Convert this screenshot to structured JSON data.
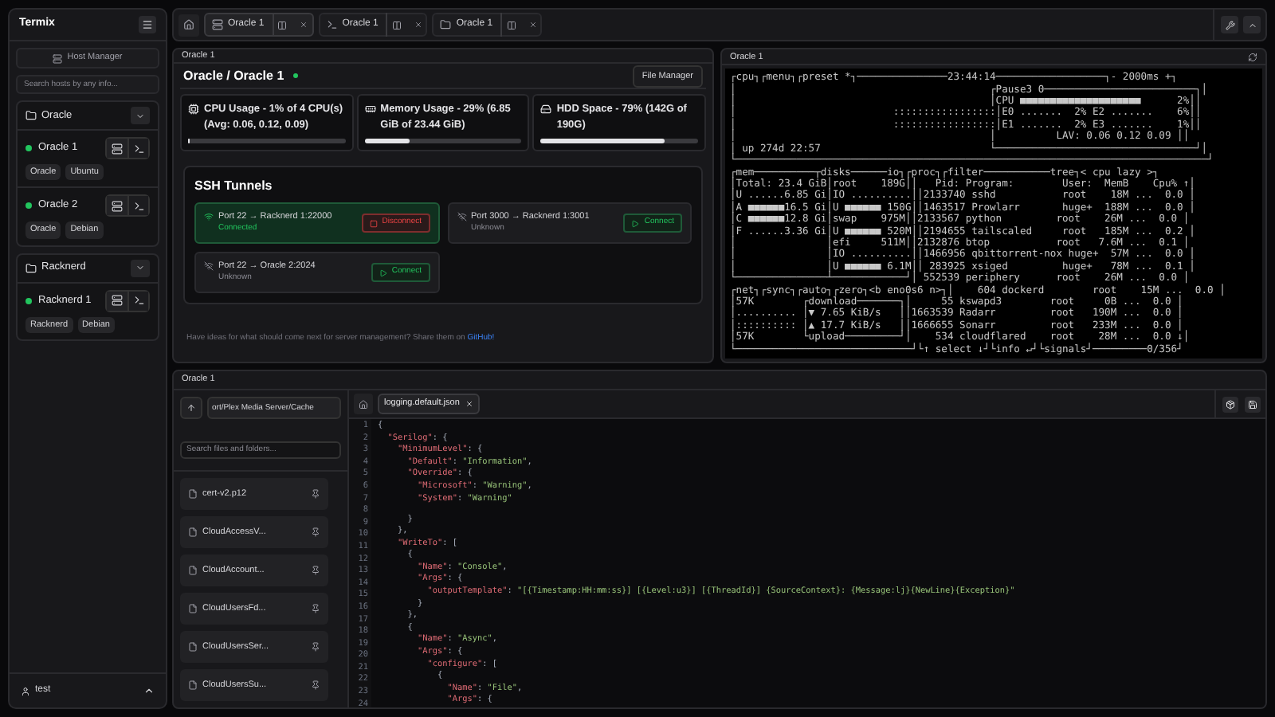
{
  "sidebar": {
    "title": "Termix",
    "host_manager": "Host Manager",
    "search": {
      "placeholder": "Search hosts by any info..."
    },
    "folders": [
      {
        "name": "Oracle",
        "expanded": true,
        "hosts": [
          {
            "name": "Oracle 1",
            "online": true,
            "tags": [
              "Oracle",
              "Ubuntu"
            ]
          },
          {
            "name": "Oracle 2",
            "online": true,
            "tags": [
              "Oracle",
              "Debian"
            ]
          }
        ]
      },
      {
        "name": "Racknerd",
        "expanded": true,
        "hosts": [
          {
            "name": "Racknerd 1",
            "online": true,
            "tags": [
              "Racknerd",
              "Debian"
            ]
          }
        ]
      }
    ],
    "user": "test"
  },
  "tabs": [
    {
      "kind": "server",
      "label": "Oracle 1",
      "selected": true
    },
    {
      "kind": "terminal",
      "label": "Oracle 1",
      "selected": false
    },
    {
      "kind": "files",
      "label": "Oracle 1",
      "selected": false
    }
  ],
  "server_panel": {
    "header": "Oracle 1",
    "title": "Oracle / Oracle 1",
    "online": true,
    "file_manager": "File Manager",
    "metrics": [
      {
        "kind": "cpu",
        "text": "CPU Usage - 1% of 4 CPU(s) (Avg: 0.06, 0.12, 0.09)",
        "level": 0.01
      },
      {
        "kind": "memory",
        "text": "Memory Usage - 29% (6.85 GiB of 23.44 GiB)",
        "level": 0.29
      },
      {
        "kind": "disk",
        "text": "HDD Space - 79% (142G of 190G)",
        "level": 0.79
      }
    ],
    "tunnels_title": "SSH Tunnels",
    "tunnels": [
      {
        "route": "Port 22 → Racknerd 1:22000",
        "kind": "connected",
        "status_text": "Connected",
        "action": "Disconnect"
      },
      {
        "route": "Port 3000 → Racknerd 1:3001",
        "kind": "unknown",
        "status_text": "Unknown",
        "action": "Connect"
      },
      {
        "route": "Port 22 → Oracle 2:2024",
        "kind": "unknown",
        "status_text": "Unknown",
        "action": "Connect"
      }
    ],
    "footer": {
      "text": "Have ideas for what should come next for server management? Share them on",
      "link": "GitHub!"
    }
  },
  "terminal_panel": {
    "header": "Oracle 1",
    "lines": [
      "┌cpu┐┌menu┐┌preset *┐───────────────23:44:14──────────────────┐- 2000ms +┐",
      "│                                          ┌Pause3 0─────────────────────────┐│",
      "│                                          │CPU ■■■■■■■■■■■■■■■■■■■■      2%││",
      "│                          :::::::::::::::::│E0 .......  2% E2 .......    6%││",
      "│                          :::::::::::::::::│E1 .......  2% E3 .......    1%││",
      "│                                          │          LAV: 0.06 0.12 0.09 ││",
      "│ up 274d 22:57                            └─────────────────────────────────┘│",
      "└──────────────────────────────────────────────────────────────────────────────┘",
      "┌mem──────────┬disks──────io┐┌proc┐┌filter───────────tree┐< cpu lazy >┐",
      "│Total: 23.4 GiB│root    189G││   Pid: Program:        User:  MemB    Cpu% ↑│",
      "│U ......6.85 Gi│IO ..........││2133740 sshd           root    18M ...  0.0 │",
      "│A ■■■■■■16.5 Gi│U ■■■■■■ 150G││1463517 Prowlarr       huge+  188M ...  0.0 │",
      "│C ■■■■■■12.8 Gi│swap    975M││2133567 python         root    26M ...  0.0 │",
      "│F ......3.36 Gi│U ■■■■■■ 520M││2194655 tailscaled     root   185M ...  0.2 │",
      "│               │efi     511M││2132876 btop           root   7.6M ...  0.1 │",
      "│               │IO ..........││1466956 qbittorrent-nox huge+  57M ...  0.0 │",
      "│               │U ■■■■■■ 6.1M││ 283925 xsiged         huge+   78M ...  0.1 │",
      "└───────────────┴────────────┘│ 552539 periphery      root    26M ...  0.0 │",
      "┌net┐┌sync┐┌auto┐┌zero┐<b eno0s6 n>┐│    604 dockerd        root    15M ...  0.0 │",
      "│57K        ┌download───────┐│     55 kswapd3        root     0B ...  0.0 │",
      "│.......... │▼ 7.65 KiB/s   ││1663539 Radarr         root   190M ...  0.0 │",
      "│:::::::::: │▲ 17.7 KiB/s   ││1666655 Sonarr         root   233M ...  0.0 │",
      "│57K        └upload─────────┘│    534 cloudflared    root    28M ...  0.0 ↓│",
      "└─────────────────────────────┘└↑ select ↓┘└info ↵┘└signals┘─────────0/356┘"
    ]
  },
  "file_panel": {
    "header": "Oracle 1",
    "path": "ort/Plex Media Server/Cache",
    "search": {
      "placeholder": "Search files and folders..."
    },
    "files": [
      "cert-v2.p12",
      "CloudAccessV...",
      "CloudAccount...",
      "CloudUsersFd...",
      "CloudUsersSer...",
      "CloudUsersSu..."
    ],
    "open_file": {
      "name": "logging.default.json",
      "selected": true
    },
    "code": [
      {
        "number": "1",
        "text": "{"
      },
      {
        "number": "2",
        "text": "  \"Serilog\": {"
      },
      {
        "number": "3",
        "text": "    \"MinimumLevel\": {"
      },
      {
        "number": "4",
        "text": "      \"Default\": \"Information\","
      },
      {
        "number": "5",
        "text": "      \"Override\": {"
      },
      {
        "number": "6",
        "text": "        \"Microsoft\": \"Warning\","
      },
      {
        "number": "7",
        "text": "        \"System\": \"Warning\""
      },
      {
        "number": "8"
      },
      {
        "number": "9",
        "text": "      }"
      },
      {
        "number": "10",
        "text": "    },"
      },
      {
        "number": "11",
        "text": "    \"WriteTo\": ["
      },
      {
        "number": "12",
        "text": "      {"
      },
      {
        "number": "13",
        "text": "        \"Name\": \"Console\","
      },
      {
        "number": "14",
        "text": "        \"Args\": {"
      },
      {
        "number": "15",
        "text": "          \"outputTemplate\": \"[{Timestamp:HH:mm:ss}] [{Level:u3}] [{ThreadId}] {SourceContext}: {Message:lj}{NewLine}{Exception}\""
      },
      {
        "number": "16",
        "text": "        }"
      },
      {
        "number": "17",
        "text": "      },"
      },
      {
        "number": "18",
        "text": "      {"
      },
      {
        "number": "19",
        "text": "        \"Name\": \"Async\","
      },
      {
        "number": "20",
        "text": "        \"Args\": {"
      },
      {
        "number": "21",
        "text": "          \"configure\": ["
      },
      {
        "number": "22",
        "text": "            {"
      },
      {
        "number": "23",
        "text": "              \"Name\": \"File\","
      },
      {
        "number": "24",
        "text": "              \"Args\": {"
      }
    ]
  }
}
